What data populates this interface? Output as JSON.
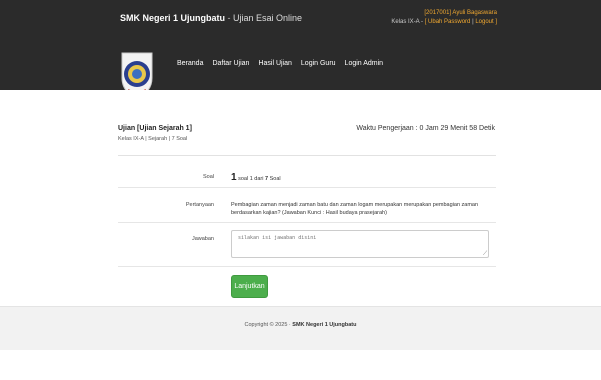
{
  "header": {
    "school": "SMK Negeri 1 Ujungbatu",
    "separator": " - ",
    "subtitle": "Ujian Esai Online",
    "user_line": "[2017001] Ayuli Bagaswara",
    "class_prefix": "Kelas IX-A - ",
    "change_password": "[ Ubah Password",
    "pipe": " | ",
    "logout": "Logout ]"
  },
  "nav": {
    "items": [
      "Beranda",
      "Daftar Ujian",
      "Hasil Ujian",
      "Login Guru",
      "Login Admin"
    ]
  },
  "exam": {
    "title": "Ujian [Ujian Sejarah 1]",
    "sub": "Kelas IX-A | Sejarah | 7 Soal",
    "timer": "Waktu Pengerjaan : 0 Jam 29 Menit 58 Detik"
  },
  "form": {
    "soal_label": "Soal",
    "soal_current": "1",
    "soal_from": " soal 1 dari ",
    "soal_total": "7",
    "soal_suffix": " Soal",
    "question_label": "Pertanyaan",
    "question_text": "Pembagian zaman menjadi zaman batu dan zaman logam merupakan merupakan pembagian zaman berdasarkan kajian? (Jawaban Kunci : Hasil budaya prasejarah)",
    "answer_label": "Jawaban",
    "answer_placeholder": "silakan isi jawaban disini",
    "submit_label": "Lanjutkan"
  },
  "footer": {
    "copyright": "Copyright © 2025 · ",
    "school": "SMK Negeri 1 Ujungbatu"
  },
  "colors": {
    "topbar": "#2b2b2b",
    "accent": "#f0a830",
    "button": "#4cae4c"
  }
}
